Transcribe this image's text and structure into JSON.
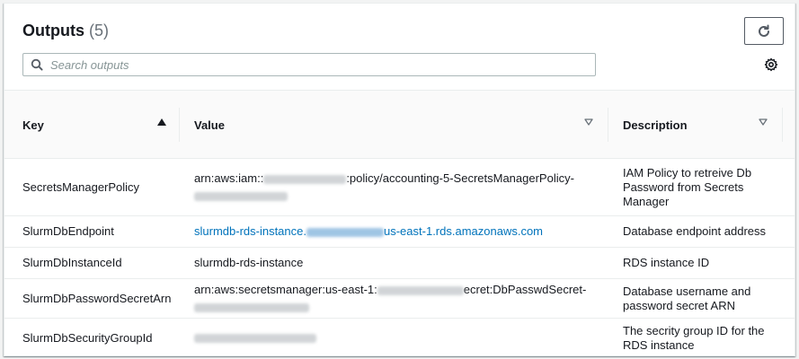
{
  "header": {
    "title": "Outputs",
    "count": "(5)"
  },
  "search": {
    "placeholder": "Search outputs"
  },
  "columns": {
    "key": "Key",
    "value": "Value",
    "description": "Description"
  },
  "rows": [
    {
      "key": "SecretsManagerPolicy",
      "value_prefix": "arn:aws:iam::",
      "value_suffix": ":policy/accounting-5-SecretsManagerPolicy-",
      "description": "IAM Policy to retreive Db Password from Secrets Manager"
    },
    {
      "key": "SlurmDbEndpoint",
      "value_prefix": "slurmdb-rds-instance.",
      "value_suffix": "us-east-1.rds.amazonaws.com",
      "description": "Database endpoint address"
    },
    {
      "key": "SlurmDbInstanceId",
      "value": "slurmdb-rds-instance",
      "description": "RDS instance ID"
    },
    {
      "key": "SlurmDbPasswordSecretArn",
      "value_prefix": "arn:aws:secretsmanager:us-east-1:",
      "value_suffix": "ecret:DbPasswdSecret-",
      "description": "Database username and password secret ARN"
    },
    {
      "key": "SlurmDbSecurityGroupId",
      "description": "The secrity group ID for the RDS instance"
    }
  ],
  "icons": {
    "refresh": "refresh-icon",
    "search": "search-icon",
    "settings": "gear-icon",
    "sort_asc": "caret-up-icon",
    "sort_filter": "caret-down-outline-icon"
  },
  "colors": {
    "link": "#0073bb",
    "border": "#eaeded",
    "text": "#16191f",
    "muted": "#687078"
  }
}
